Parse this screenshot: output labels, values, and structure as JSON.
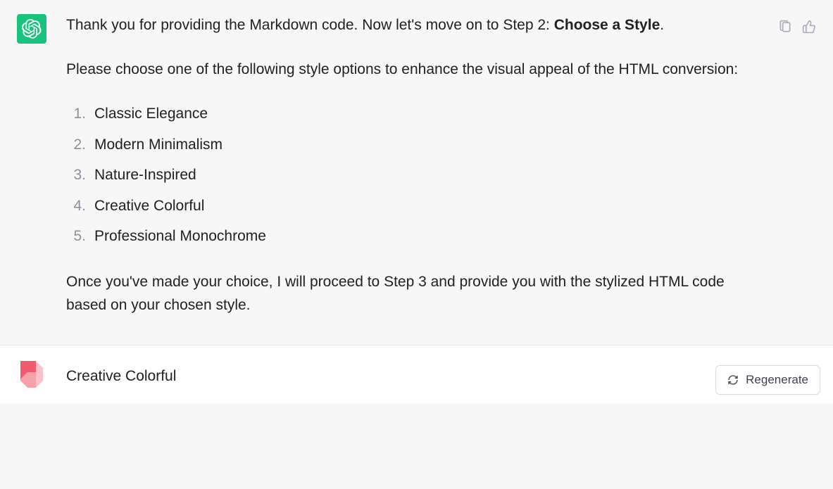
{
  "ai_message": {
    "intro_pre": "Thank you for providing the Markdown code. Now let's move on to Step 2: ",
    "intro_bold": "Choose a Style",
    "intro_post": ".",
    "prompt": "Please choose one of the following style options to enhance the visual appeal of the HTML conversion:",
    "options": [
      "Classic Elegance",
      "Modern Minimalism",
      "Nature-Inspired",
      "Creative Colorful",
      "Professional Monochrome"
    ],
    "outro": "Once you've made your choice, I will proceed to Step 3 and provide you with the stylized HTML code based on your chosen style."
  },
  "user_message": {
    "text": "Creative Colorful"
  },
  "actions": {
    "regenerate_label": "Regenerate"
  }
}
